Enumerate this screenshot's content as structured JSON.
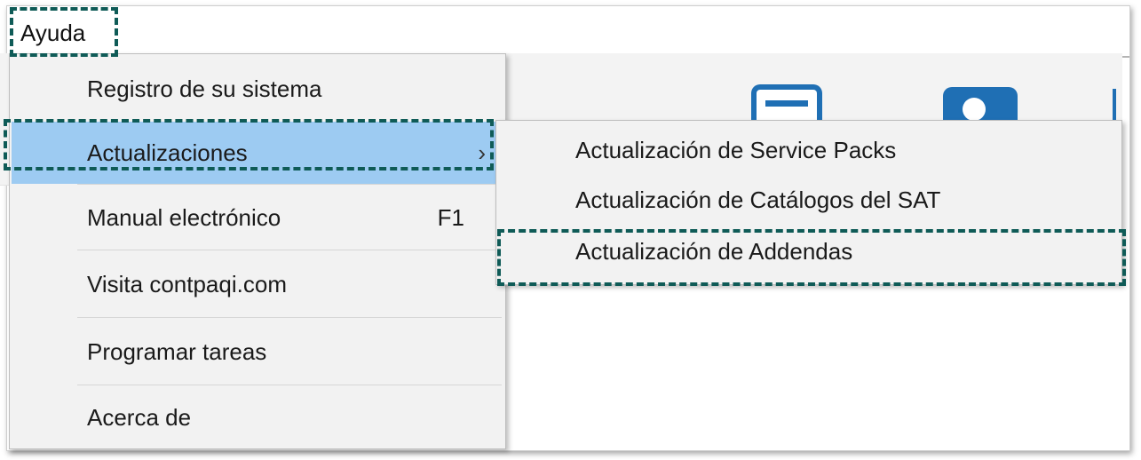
{
  "menubar": {
    "help_label": "Ayuda"
  },
  "help_menu": {
    "items": [
      {
        "label": "Registro de su sistema"
      },
      {
        "label": "Actualizaciones",
        "submenu_arrow": "›"
      },
      {
        "label": "Manual electrónico",
        "shortcut": "F1"
      },
      {
        "label": "Visita contpaqi.com"
      },
      {
        "label": "Programar tareas"
      },
      {
        "label": "Acerca de"
      }
    ]
  },
  "updates_submenu": {
    "items": [
      {
        "label": "Actualización de Service Packs"
      },
      {
        "label": "Actualización de Catálogos del SAT"
      },
      {
        "label": "Actualización de Addendas"
      }
    ]
  },
  "colors": {
    "highlight": "#9dcbf2",
    "callout": "#0f5b57",
    "toolbar_icon": "#1f6fb4"
  }
}
